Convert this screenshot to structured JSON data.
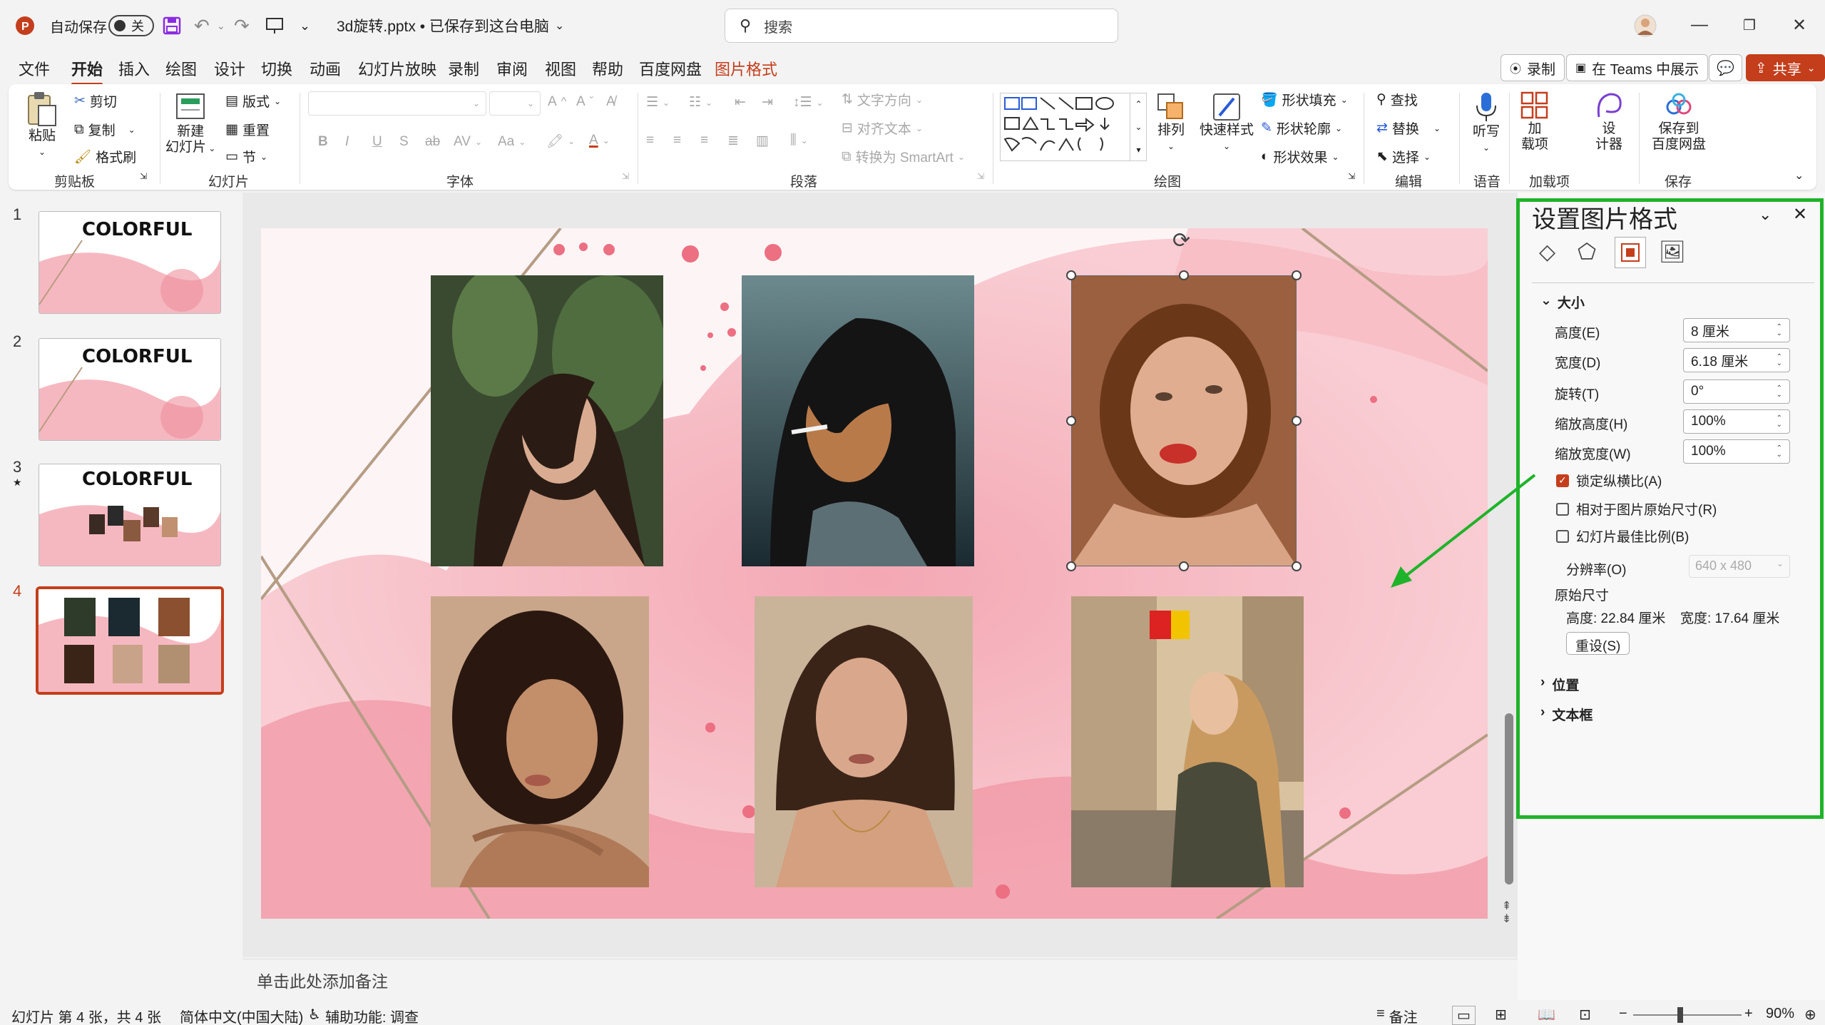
{
  "titlebar": {
    "autosave_label": "自动保存",
    "autosave_state": "关",
    "filename": "3d旋转.pptx • 已保存到这台电脑",
    "search_placeholder": "搜索"
  },
  "menu": {
    "items": [
      "文件",
      "开始",
      "插入",
      "绘图",
      "设计",
      "切换",
      "动画",
      "幻灯片放映",
      "录制",
      "审阅",
      "视图",
      "帮助",
      "百度网盘",
      "图片格式"
    ],
    "active": "开始",
    "record_label": "录制",
    "teams_label": "在 Teams 中展示",
    "share_label": "共享"
  },
  "ribbon": {
    "clipboard": {
      "paste": "粘贴",
      "cut": "剪切",
      "copy": "复制",
      "format_painter": "格式刷",
      "group": "剪贴板"
    },
    "slides": {
      "new_slide_line1": "新建",
      "new_slide_line2": "幻灯片",
      "layout": "版式",
      "reset": "重置",
      "section": "节",
      "group": "幻灯片"
    },
    "font": {
      "group": "字体"
    },
    "paragraph": {
      "text_direction": "文字方向",
      "align_text": "对齐文本",
      "smartart": "转换为 SmartArt",
      "group": "段落"
    },
    "drawing": {
      "arrange": "排列",
      "quick_styles": "快速样式",
      "shape_fill": "形状填充",
      "shape_outline": "形状轮廓",
      "shape_effects": "形状效果",
      "group": "绘图"
    },
    "editing": {
      "find": "查找",
      "replace": "替换",
      "select": "选择",
      "group": "编辑"
    },
    "voice": {
      "dictate": "听写",
      "group": "语音"
    },
    "addins": {
      "addins_line1": "加",
      "addins_line2": "载项",
      "group": "加载项"
    },
    "designer": {
      "line1": "设",
      "line2": "计器"
    },
    "save": {
      "line1": "保存到",
      "line2": "百度网盘",
      "group": "保存"
    }
  },
  "thumbnails": [
    {
      "num": "1",
      "title": "COLORFUL"
    },
    {
      "num": "2",
      "title": "COLORFUL"
    },
    {
      "num": "3",
      "title": "COLORFUL"
    },
    {
      "num": "4",
      "title": ""
    }
  ],
  "notes_placeholder": "单击此处添加备注",
  "format_pane": {
    "title": "设置图片格式",
    "section_size": "大小",
    "height_label": "高度(E)",
    "height_value": "8 厘米",
    "width_label": "宽度(D)",
    "width_value": "6.18 厘米",
    "rotation_label": "旋转(T)",
    "rotation_value": "0°",
    "scale_h_label": "缩放高度(H)",
    "scale_h_value": "100%",
    "scale_w_label": "缩放宽度(W)",
    "scale_w_value": "100%",
    "lock_aspect": "锁定纵横比(A)",
    "relative_original": "相对于图片原始尺寸(R)",
    "best_scale": "幻灯片最佳比例(B)",
    "resolution_label": "分辨率(O)",
    "resolution_value": "640 x 480",
    "original_size_label": "原始尺寸",
    "original_height": "高度:  22.84 厘米",
    "original_width": "宽度:  17.64 厘米",
    "reset_button": "重设(S)",
    "section_position": "位置",
    "section_textbox": "文本框"
  },
  "status": {
    "slide_info": "幻灯片 第 4 张，共 4 张",
    "language": "简体中文(中国大陆)",
    "accessibility": "辅助功能: 调查",
    "notes": "备注",
    "zoom": "90%"
  },
  "colors": {
    "accent": "#c43e1c",
    "highlight_green": "#1fb32a",
    "slide_pink": "#f4a6b0"
  }
}
